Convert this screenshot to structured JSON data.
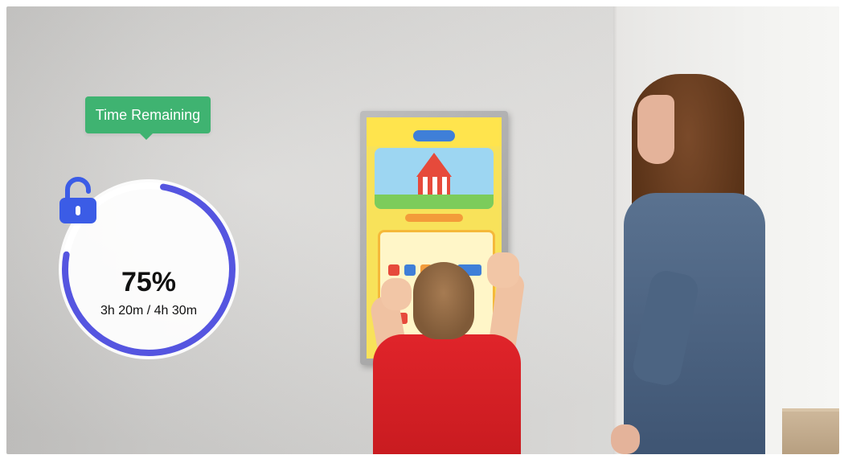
{
  "photo": {
    "description_icons": [
      "lock-icon"
    ]
  },
  "time_widget": {
    "tag_label": "Time Remaining",
    "percent_label": "75%",
    "progress_fraction": 0.75,
    "times_label": "3h 20m / 4h 30m",
    "ring_color": "#5555e0",
    "ring_track_color": "#ffffff",
    "tag_color": "#3fb371",
    "lock_color": "#3b5ce6"
  }
}
